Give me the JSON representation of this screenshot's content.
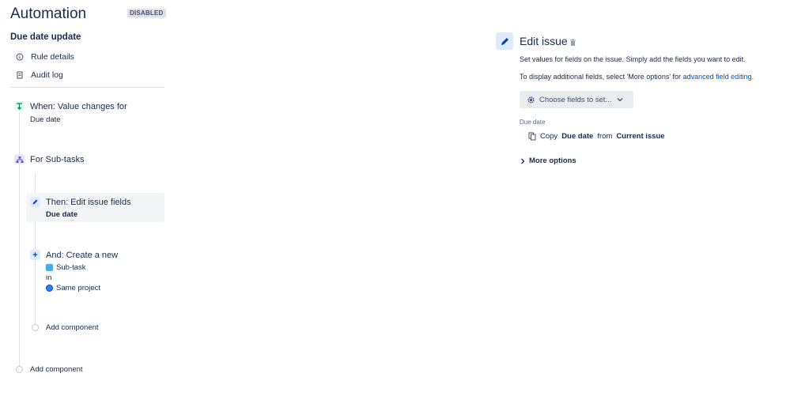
{
  "header": {
    "title": "Automation",
    "status_badge": "DISABLED"
  },
  "rule": {
    "name": "Due date update"
  },
  "nav": [
    {
      "label": "Rule details",
      "icon": "info-icon"
    },
    {
      "label": "Audit log",
      "icon": "clipboard-icon"
    }
  ],
  "flow": {
    "trigger": {
      "title": "When: Value changes for",
      "detail": "Due date",
      "icon": "trigger-icon"
    },
    "branch": {
      "title": "For Sub-tasks",
      "icon": "branch-icon"
    },
    "action": {
      "title": "Then: Edit issue fields",
      "detail": "Due date",
      "icon": "pencil-icon"
    },
    "create": {
      "title": "And: Create a new",
      "issue_type": "Sub-task",
      "in_label": "in",
      "project": "Same project",
      "icon": "plus-icon"
    },
    "add_component_inner": "Add component",
    "add_component_outer": "Add component"
  },
  "panel": {
    "title": "Edit issue",
    "description": "Set values for fields on the issue. Simply add the fields you want to edit.",
    "hint_prefix": "To display additional fields, select 'More options' for",
    "hint_link": "advanced field editing",
    "hint_suffix": ".",
    "choose_fields_label": "Choose fields to set...",
    "field_label": "Due date",
    "copy": {
      "verb": "Copy",
      "field": "Due date",
      "from": "from",
      "source": "Current issue"
    },
    "more_options_label": "More options"
  },
  "colors": {
    "accent": "#0052cc",
    "selected_bg": "#f4f5f7",
    "trigger_green": "#00875a",
    "branch_purple": "#6554c0"
  }
}
